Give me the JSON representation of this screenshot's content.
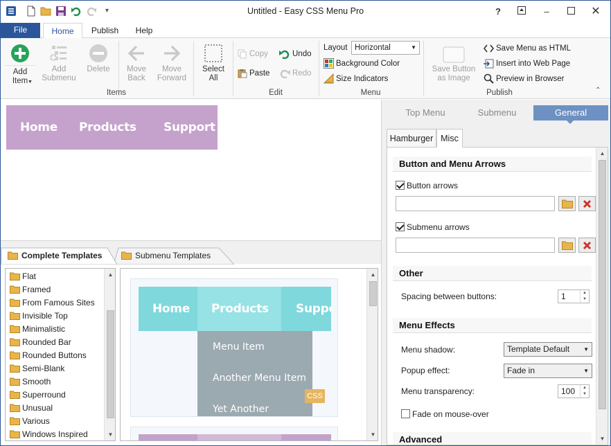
{
  "window": {
    "title": "Untitled - Easy CSS Menu Pro"
  },
  "ribbon_tabs": {
    "file": "File",
    "home": "Home",
    "publish": "Publish",
    "help": "Help"
  },
  "items_group": {
    "label": "Items",
    "add_item": "Add\nItem",
    "add_submenu": "Add\nSubmenu",
    "delete": "Delete",
    "move_back": "Move\nBack",
    "move_forward": "Move\nForward",
    "select_all": "Select\nAll"
  },
  "edit_group": {
    "label": "Edit",
    "copy": "Copy",
    "paste": "Paste",
    "undo": "Undo",
    "redo": "Redo"
  },
  "menu_group": {
    "label": "Menu",
    "layout_label": "Layout",
    "layout_value": "Horizontal",
    "background_color": "Background Color",
    "size_indicators": "Size Indicators"
  },
  "publish_group": {
    "label": "Publish",
    "save_button_image": "Save Button\nas Image",
    "save_menu_html": "Save Menu as HTML",
    "insert_web_page": "Insert into Web Page",
    "preview_browser": "Preview in Browser"
  },
  "preview_menu": {
    "items": [
      "Home",
      "Products",
      "Support"
    ],
    "bg_color": "#c4a2cb"
  },
  "template_tabs": {
    "complete": "Complete Templates",
    "submenu": "Submenu Templates"
  },
  "template_folders": [
    "Flat",
    "Framed",
    "From Famous Sites",
    "Invisible Top",
    "Minimalistic",
    "Rounded Bar",
    "Rounded Buttons",
    "Semi-Blank",
    "Smooth",
    "Superround",
    "Unusual",
    "Various",
    "Windows Inspired"
  ],
  "template_preview": {
    "top_items": [
      "Home",
      "Products",
      "Suppor"
    ],
    "sub_items": [
      "Menu Item",
      "Another Menu Item",
      "Yet Another"
    ],
    "badge": "CSS",
    "accent": "#7ed8dc"
  },
  "property_tabs": {
    "top_menu": "Top Menu",
    "submenu": "Submenu",
    "general": "General"
  },
  "sub_tabs": {
    "hamburger": "Hamburger",
    "misc": "Misc"
  },
  "options": {
    "button_arrows_section": "Button and Menu Arrows",
    "button_arrows": "Button arrows",
    "submenu_arrows": "Submenu arrows",
    "other_section": "Other",
    "spacing_label": "Spacing between buttons:",
    "spacing_value": "1",
    "effects_section": "Menu Effects",
    "menu_shadow_label": "Menu shadow:",
    "menu_shadow_value": "Template Default",
    "popup_effect_label": "Popup effect:",
    "popup_effect_value": "Fade in",
    "transparency_label": "Menu transparency:",
    "transparency_value": "100",
    "fade_label": "Fade on mouse-over",
    "advanced_section": "Advanced"
  }
}
